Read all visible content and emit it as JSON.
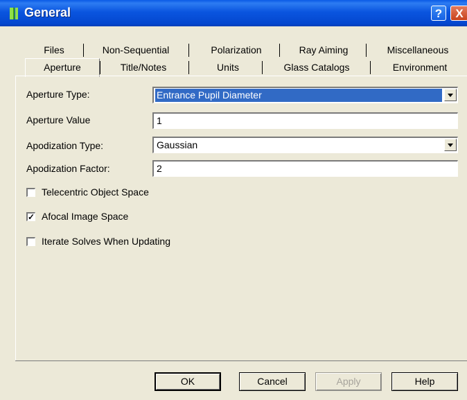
{
  "window": {
    "title": "General",
    "help_glyph": "?",
    "close_glyph": "X"
  },
  "tabs_row1": [
    "Files",
    "Non-Sequential",
    "Polarization",
    "Ray Aiming",
    "Miscellaneous"
  ],
  "tabs_row2": [
    "Aperture",
    "Title/Notes",
    "Units",
    "Glass Catalogs",
    "Environment"
  ],
  "active_tab": "Aperture",
  "form": {
    "aperture_type": {
      "label": "Aperture Type:",
      "value": "Entrance Pupil Diameter"
    },
    "aperture_value": {
      "label": "Aperture Value",
      "value": "1"
    },
    "apodization_type": {
      "label": "Apodization Type:",
      "value": "Gaussian"
    },
    "apodization_factor": {
      "label": "Apodization Factor:",
      "value": "2"
    }
  },
  "checkboxes": [
    {
      "label": "Telecentric Object Space",
      "checked": false,
      "mark": ""
    },
    {
      "label": "Afocal Image Space",
      "checked": true,
      "mark": "✓"
    },
    {
      "label": "Iterate Solves When Updating",
      "checked": false,
      "mark": ""
    }
  ],
  "buttons": {
    "ok": "OK",
    "cancel": "Cancel",
    "apply": "Apply",
    "help": "Help"
  },
  "colors": {
    "titlebar": "#0a55df",
    "selection": "#316ac5",
    "dialog_bg": "#ece9d8"
  }
}
